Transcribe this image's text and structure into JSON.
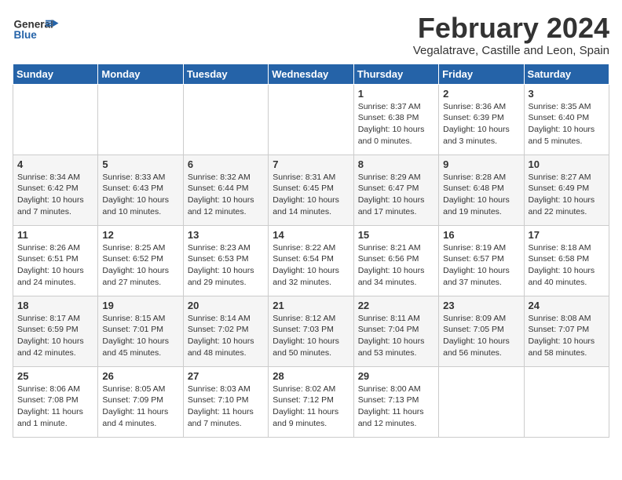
{
  "header": {
    "logo_general": "General",
    "logo_blue": "Blue",
    "month_title": "February 2024",
    "subtitle": "Vegalatrave, Castille and Leon, Spain"
  },
  "weekdays": [
    "Sunday",
    "Monday",
    "Tuesday",
    "Wednesday",
    "Thursday",
    "Friday",
    "Saturday"
  ],
  "weeks": [
    [
      {
        "day": "",
        "info": ""
      },
      {
        "day": "",
        "info": ""
      },
      {
        "day": "",
        "info": ""
      },
      {
        "day": "",
        "info": ""
      },
      {
        "day": "1",
        "info": "Sunrise: 8:37 AM\nSunset: 6:38 PM\nDaylight: 10 hours\nand 0 minutes."
      },
      {
        "day": "2",
        "info": "Sunrise: 8:36 AM\nSunset: 6:39 PM\nDaylight: 10 hours\nand 3 minutes."
      },
      {
        "day": "3",
        "info": "Sunrise: 8:35 AM\nSunset: 6:40 PM\nDaylight: 10 hours\nand 5 minutes."
      }
    ],
    [
      {
        "day": "4",
        "info": "Sunrise: 8:34 AM\nSunset: 6:42 PM\nDaylight: 10 hours\nand 7 minutes."
      },
      {
        "day": "5",
        "info": "Sunrise: 8:33 AM\nSunset: 6:43 PM\nDaylight: 10 hours\nand 10 minutes."
      },
      {
        "day": "6",
        "info": "Sunrise: 8:32 AM\nSunset: 6:44 PM\nDaylight: 10 hours\nand 12 minutes."
      },
      {
        "day": "7",
        "info": "Sunrise: 8:31 AM\nSunset: 6:45 PM\nDaylight: 10 hours\nand 14 minutes."
      },
      {
        "day": "8",
        "info": "Sunrise: 8:29 AM\nSunset: 6:47 PM\nDaylight: 10 hours\nand 17 minutes."
      },
      {
        "day": "9",
        "info": "Sunrise: 8:28 AM\nSunset: 6:48 PM\nDaylight: 10 hours\nand 19 minutes."
      },
      {
        "day": "10",
        "info": "Sunrise: 8:27 AM\nSunset: 6:49 PM\nDaylight: 10 hours\nand 22 minutes."
      }
    ],
    [
      {
        "day": "11",
        "info": "Sunrise: 8:26 AM\nSunset: 6:51 PM\nDaylight: 10 hours\nand 24 minutes."
      },
      {
        "day": "12",
        "info": "Sunrise: 8:25 AM\nSunset: 6:52 PM\nDaylight: 10 hours\nand 27 minutes."
      },
      {
        "day": "13",
        "info": "Sunrise: 8:23 AM\nSunset: 6:53 PM\nDaylight: 10 hours\nand 29 minutes."
      },
      {
        "day": "14",
        "info": "Sunrise: 8:22 AM\nSunset: 6:54 PM\nDaylight: 10 hours\nand 32 minutes."
      },
      {
        "day": "15",
        "info": "Sunrise: 8:21 AM\nSunset: 6:56 PM\nDaylight: 10 hours\nand 34 minutes."
      },
      {
        "day": "16",
        "info": "Sunrise: 8:19 AM\nSunset: 6:57 PM\nDaylight: 10 hours\nand 37 minutes."
      },
      {
        "day": "17",
        "info": "Sunrise: 8:18 AM\nSunset: 6:58 PM\nDaylight: 10 hours\nand 40 minutes."
      }
    ],
    [
      {
        "day": "18",
        "info": "Sunrise: 8:17 AM\nSunset: 6:59 PM\nDaylight: 10 hours\nand 42 minutes."
      },
      {
        "day": "19",
        "info": "Sunrise: 8:15 AM\nSunset: 7:01 PM\nDaylight: 10 hours\nand 45 minutes."
      },
      {
        "day": "20",
        "info": "Sunrise: 8:14 AM\nSunset: 7:02 PM\nDaylight: 10 hours\nand 48 minutes."
      },
      {
        "day": "21",
        "info": "Sunrise: 8:12 AM\nSunset: 7:03 PM\nDaylight: 10 hours\nand 50 minutes."
      },
      {
        "day": "22",
        "info": "Sunrise: 8:11 AM\nSunset: 7:04 PM\nDaylight: 10 hours\nand 53 minutes."
      },
      {
        "day": "23",
        "info": "Sunrise: 8:09 AM\nSunset: 7:05 PM\nDaylight: 10 hours\nand 56 minutes."
      },
      {
        "day": "24",
        "info": "Sunrise: 8:08 AM\nSunset: 7:07 PM\nDaylight: 10 hours\nand 58 minutes."
      }
    ],
    [
      {
        "day": "25",
        "info": "Sunrise: 8:06 AM\nSunset: 7:08 PM\nDaylight: 11 hours\nand 1 minute."
      },
      {
        "day": "26",
        "info": "Sunrise: 8:05 AM\nSunset: 7:09 PM\nDaylight: 11 hours\nand 4 minutes."
      },
      {
        "day": "27",
        "info": "Sunrise: 8:03 AM\nSunset: 7:10 PM\nDaylight: 11 hours\nand 7 minutes."
      },
      {
        "day": "28",
        "info": "Sunrise: 8:02 AM\nSunset: 7:12 PM\nDaylight: 11 hours\nand 9 minutes."
      },
      {
        "day": "29",
        "info": "Sunrise: 8:00 AM\nSunset: 7:13 PM\nDaylight: 11 hours\nand 12 minutes."
      },
      {
        "day": "",
        "info": ""
      },
      {
        "day": "",
        "info": ""
      }
    ]
  ]
}
